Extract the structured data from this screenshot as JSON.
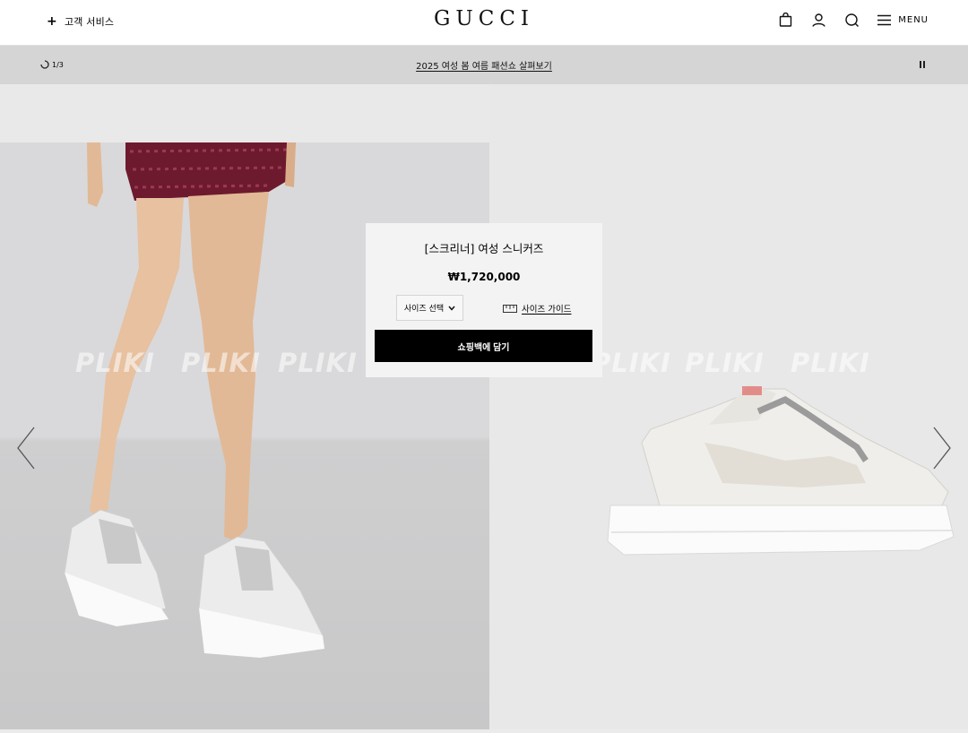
{
  "header": {
    "customer_service_label": "고객 서비스",
    "logo_text": "GUCCI",
    "menu_label": "MENU"
  },
  "announcement": {
    "counter": "1/3",
    "link_text": "2025 여성 봄 여름 패션쇼 살펴보기"
  },
  "product": {
    "title": "[스크리너] 여성 스니커즈",
    "price": "₩1,720,000",
    "size_select_label": "사이즈 선택",
    "size_guide_label": "사이즈 가이드",
    "add_to_bag_label": "쇼핑백에 담기"
  },
  "watermark": {
    "text": "PLIKI"
  },
  "icons": {
    "plus": "plus-icon",
    "bag": "shopping-bag-icon",
    "account": "user-icon",
    "search": "search-icon",
    "menu": "hamburger-menu-icon",
    "loader": "loading-spinner-icon",
    "pause": "pause-icon",
    "ruler": "ruler-icon",
    "chevron": "chevron-down-icon",
    "prev": "chevron-left-icon",
    "next": "chevron-right-icon"
  }
}
